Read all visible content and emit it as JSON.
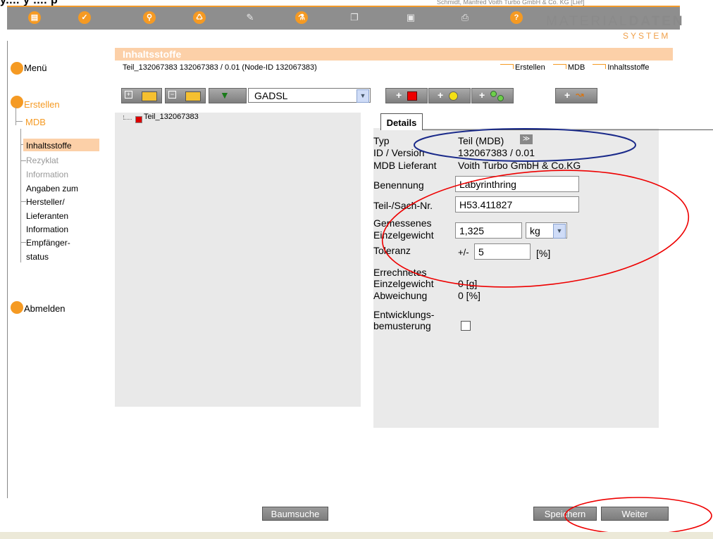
{
  "top": {
    "title": "y.... y .... p",
    "strip_text": "Schmidt, Manfred  Voith Turbo GmbH & Co. KG [Lief]"
  },
  "toolbar": {
    "icons": [
      "save-icon",
      "check-icon",
      "search-icon",
      "recycle-icon",
      "pencil-icon",
      "flask-icon",
      "copy-icon",
      "paste-icon",
      "print-icon",
      "help-icon"
    ],
    "check_glyph": "✓",
    "help_glyph": "?"
  },
  "logo": {
    "line1a": "MATERIAL",
    "line1b": "DATEN",
    "line2": "SYSTEM"
  },
  "nav": {
    "menu": "Menü",
    "create": "Erstellen",
    "mdb": "MDB",
    "items": [
      "Inhaltsstoffe",
      "Rezyklat",
      "Information",
      "Angaben zum",
      "Hersteller/",
      "Lieferanten",
      "Information",
      "Empfänger-",
      "status"
    ],
    "logout": "Abmelden"
  },
  "header": {
    "title": "Inhaltsstoffe",
    "subtitle": "Teil_132067383 132067383 / 0.01 (Node-ID 132067383)",
    "breadcrumb": [
      "Erstellen",
      "MDB",
      "Inhaltsstoffe"
    ]
  },
  "controls": {
    "select_value": "GADSL",
    "add_labels": [
      "+",
      "+",
      "+",
      "+"
    ]
  },
  "tree": {
    "root": "Teil_132067383"
  },
  "details": {
    "tab": "Details",
    "typ_label": "Typ",
    "typ_value": "Teil (MDB)",
    "id_label": "ID / Version",
    "id_value": "132067383 / 0.01",
    "lieferant_label": "MDB Lieferant",
    "lieferant_value": "Voith Turbo GmbH & Co.KG",
    "benennung_label": "Benennung",
    "benennung_value": "Labyrinthring",
    "sachnr_label": "Teil-/Sach-Nr.",
    "sachnr_value": "H53.411827",
    "gemessen_label1": "Gemessenes",
    "gemessen_label2": "Einzelgewicht",
    "gemessen_value": "1,325",
    "unit_value": "kg",
    "toleranz_label": "Toleranz",
    "toleranz_prefix": "+/-",
    "toleranz_value": "5",
    "toleranz_unit": "[%]",
    "errechnet_label1": "Errechnetes",
    "errechnet_label2": "Einzelgewicht",
    "errechnet_value": "0 [g]",
    "abweichung_label": "Abweichung",
    "abweichung_value": "0 [%]",
    "entw_label1": "Entwicklungs-",
    "entw_label2": "bemusterung"
  },
  "buttons": {
    "tree_search": "Baumsuche",
    "save": "Speichern",
    "next": "Weiter"
  }
}
